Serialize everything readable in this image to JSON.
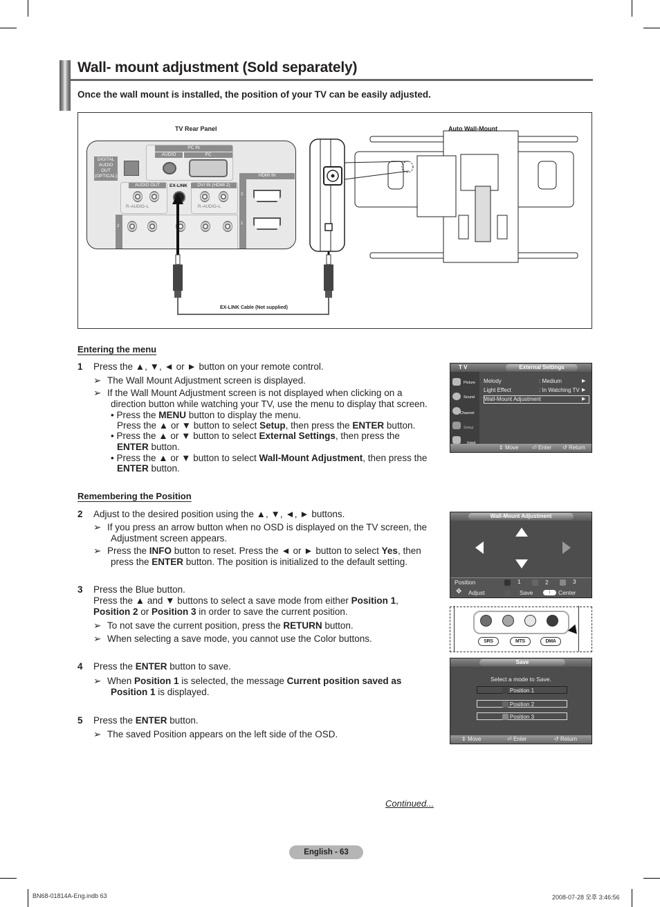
{
  "header": {
    "title": "Wall- mount adjustment (Sold separately)",
    "intro": "Once the wall mount is installed, the position of your TV can be easily adjusted."
  },
  "diagram": {
    "tv_rear_panel_label": "TV Rear Panel",
    "auto_wall_mount_label": "Auto Wall-Mount",
    "cable_label": "EX-LINK Cable (Not supplied)",
    "ports": {
      "pc_in": "PC IN",
      "audio": "AUDIO",
      "pc": "PC",
      "digital_audio_out": [
        "DIGITAL",
        "AUDIO",
        "OUT",
        "(OPTICAL)"
      ],
      "audio_out": "AUDIO OUT",
      "ex_link": "EX-LINK",
      "dvi_in": "DVI IN (HDMI 2)",
      "hdmi_in": "HDMI IN",
      "audio_rl": "R–AUDIO–L",
      "hdmi_2": "2",
      "hdmi_1": "1",
      "component_2": "2"
    }
  },
  "sections": {
    "entering": {
      "heading": "Entering the menu",
      "step1_num": "1",
      "step1": "Press the ▲, ▼, ◄ or ► button on your remote control.",
      "note1": "The Wall Mount Adjustment screen is displayed.",
      "note2_l1": "If the Wall Mount Adjustment screen is not displayed when clicking on a",
      "note2_l2": "direction button while watching your TV, use the menu to display that screen.",
      "bullet1_a": "• Press the ",
      "bullet1_b": "MENU",
      "bullet1_c": " button to display the menu.",
      "bullet1_l2_a": "Press the ▲ or ▼ button to select ",
      "bullet1_l2_b": "Setup",
      "bullet1_l2_c": ", then press the ",
      "bullet1_l2_d": "ENTER",
      "bullet1_l2_e": " button.",
      "bullet2_a": "• Press the ▲ or ▼ button to select ",
      "bullet2_b": "External Settings",
      "bullet2_c": ", then press the",
      "bullet2_l2_a": "ENTER",
      "bullet2_l2_b": " button.",
      "bullet3_a": "• Press the ▲ or ▼ button to select ",
      "bullet3_b": "Wall-Mount Adjustment",
      "bullet3_c": ", then press the",
      "bullet3_l2_a": "ENTER",
      "bullet3_l2_b": " button."
    },
    "remembering": {
      "heading": "Remembering the Position",
      "step2_num": "2",
      "step2": "Adjust to the desired position using the ▲, ▼, ◄, ► buttons.",
      "s2_note1_l1": "If you press an arrow button when no OSD is displayed on the TV screen, the",
      "s2_note1_l2": "Adjustment screen appears.",
      "s2_note2_a": "Press the ",
      "s2_note2_b": "INFO",
      "s2_note2_c": " button to reset. Press the ◄ or ► button to select ",
      "s2_note2_d": "Yes",
      "s2_note2_e": ", then",
      "s2_note2_l2_a": "press the ",
      "s2_note2_l2_b": "ENTER",
      "s2_note2_l2_c": " button. The position is initialized to the default setting.",
      "step3_num": "3",
      "step3_l1": "Press the Blue button.",
      "step3_l2_a": "Press the ▲ and ▼ buttons to select a save mode from either ",
      "step3_l2_b": "Position 1",
      "step3_l2_c": ",",
      "step3_l3_a": "Position 2",
      "step3_l3_b": " or ",
      "step3_l3_c": "Position 3",
      "step3_l3_d": " in order to save the current position.",
      "s3_note1_a": "To not save the current position, press the ",
      "s3_note1_b": "RETURN",
      "s3_note1_c": " button.",
      "s3_note2": "When selecting a save mode, you cannot use the Color buttons.",
      "step4_num": "4",
      "step4_a": "Press the ",
      "step4_b": "ENTER",
      "step4_c": " button to save.",
      "s4_note_a": "When ",
      "s4_note_b": "Position 1",
      "s4_note_c": " is selected, the message ",
      "s4_note_d": "Current position saved as",
      "s4_note_l2_a": "Position 1",
      "s4_note_l2_b": " is displayed.",
      "step5_num": "5",
      "step5_a": "Press the ",
      "step5_b": "ENTER",
      "step5_c": " button.",
      "s5_note": "The saved Position appears on the left side of the OSD."
    }
  },
  "osd_external": {
    "tv_label": "T V",
    "title": "External Settings",
    "sidebar": [
      "Picture",
      "Sound",
      "Channel",
      "Setup",
      "Input"
    ],
    "rows": [
      {
        "label": "Melody",
        "value": ": Medium"
      },
      {
        "label": "Light Effect",
        "value": ": In Watching TV"
      },
      {
        "label": "Wall-Mount Adjustment",
        "value": ""
      }
    ],
    "footer": {
      "move": "Move",
      "enter": "Enter",
      "return": "Return"
    }
  },
  "osd_adjust": {
    "title": "Wall-Mount Adjustment",
    "position_label": "Position",
    "positions": [
      "1",
      "2",
      "3"
    ],
    "adjust_label": "Adjust",
    "save_label": "Save",
    "center_label": "Center",
    "center_key": "i"
  },
  "remote": {
    "buttons": [
      "SRS",
      "MTS",
      "DMA"
    ],
    "colors": [
      "#6e6e6e",
      "#a5a5a5",
      "#e6e6e6",
      "#3c3c3c"
    ]
  },
  "osd_save": {
    "title": "Save",
    "prompt": "Select a mode to Save.",
    "options": [
      "Position 1",
      "Position 2",
      "Position 3"
    ],
    "footer": {
      "move": "Move",
      "enter": "Enter",
      "return": "Return"
    }
  },
  "footer": {
    "continued": "Continued...",
    "page_label": "English - 63",
    "file_info": "BN68-01814A-Eng.indb   63",
    "timestamp": "2008-07-28   오후 3:46:56"
  }
}
